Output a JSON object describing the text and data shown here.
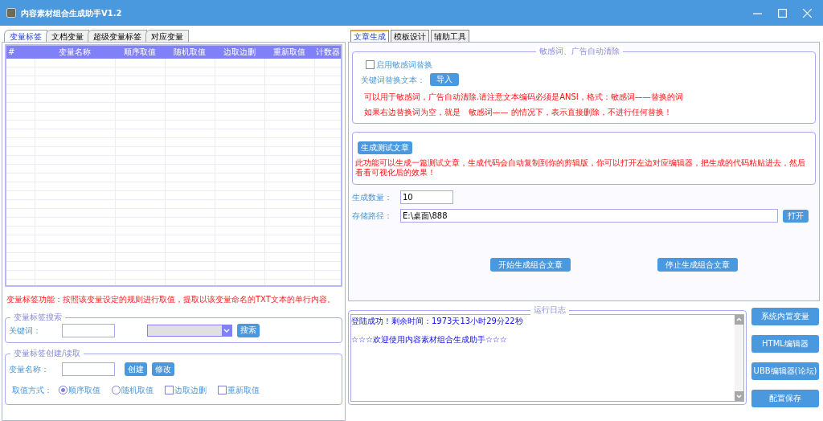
{
  "window": {
    "title": "内容素材组合生成助手V1.2"
  },
  "left_tabs": [
    {
      "label": "变量标签",
      "selected": true
    },
    {
      "label": "文档变量",
      "selected": false
    },
    {
      "label": "超级变量标签",
      "selected": false
    },
    {
      "label": "对应变量",
      "selected": false
    }
  ],
  "table": {
    "columns": [
      "#",
      "变量名称",
      "顺序取值",
      "随机取值",
      "边取边删",
      "重新取值",
      "计数器"
    ]
  },
  "left_note": "变量标签功能：按照该变量设定的规则进行取值，提取以该变量命名的TXT文本的单行内容。",
  "search_group": {
    "title": "变量标签搜索",
    "keyword_label": "关键词：",
    "button": "搜索"
  },
  "create_group": {
    "title": "变量标签创建/读取",
    "name_label": "变量名称：",
    "buttons": [
      "创建",
      "修改"
    ],
    "mode_label": "取值方式：",
    "options": [
      {
        "kind": "radio",
        "label": "顺序取值",
        "checked": true
      },
      {
        "kind": "radio",
        "label": "随机取值",
        "checked": false
      },
      {
        "kind": "checkbox",
        "label": "边取边删",
        "checked": false
      },
      {
        "kind": "checkbox",
        "label": "重新取值",
        "checked": false
      }
    ]
  },
  "right_tabs": [
    {
      "label": "文章生成",
      "selected": true
    },
    {
      "label": "模板设计",
      "selected": false
    },
    {
      "label": "辅助工具",
      "selected": false
    }
  ],
  "sensitive_group": {
    "title": "敏感词、广告自动清除",
    "enable_label": "启用敏感词替换",
    "enabled": false,
    "import_label": "关键词替换文本：",
    "import_button": "导入",
    "notes": [
      "可以用于敏感词，广告自动清除.请注意文本编码必须是ANSI，格式：敏感词——替换的词",
      "如果右边替换词为空，就是   敏感词—— 的情况下，表示直接删除，不进行任何替换！"
    ]
  },
  "test_group": {
    "button": "生成测试文章",
    "note": "此功能可以生成一篇测试文章，生成代码会自动复制到你的剪辑版，你可以打开左边对应编辑器，把生成的代码粘贴进去，然后看看可视化后的效果！"
  },
  "count_field": {
    "label": "生成数量：",
    "value": "10"
  },
  "path_field": {
    "label": "存储路径：",
    "value": "E:\\桌面\\888",
    "button": "打开"
  },
  "actions": [
    "开始生成组合文章",
    "停止生成组合文章"
  ],
  "log": {
    "title": "运行日志",
    "lines": [
      "登陆成功！剩余时间：1973天13小时29分22秒",
      "☆☆☆欢迎使用内容素材组合生成助手☆☆☆"
    ]
  },
  "side_buttons": [
    "系统内置变量",
    "HTML编辑器",
    "UBB编辑器(论坛)",
    "配置保存"
  ]
}
